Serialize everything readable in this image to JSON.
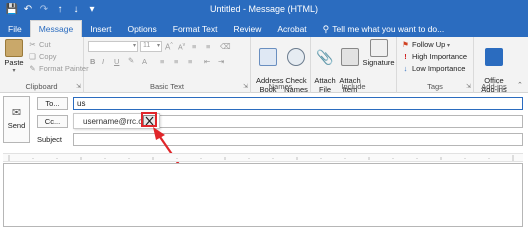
{
  "window": {
    "title": "Untitled - Message (HTML)"
  },
  "qat": {
    "icons": [
      "save-icon",
      "undo-icon",
      "redo-icon",
      "up-arrow-icon",
      "down-arrow-icon",
      "customize-icon"
    ]
  },
  "tabs": [
    {
      "label": "File",
      "active": false
    },
    {
      "label": "Message",
      "active": true
    },
    {
      "label": "Insert",
      "active": false
    },
    {
      "label": "Options",
      "active": false
    },
    {
      "label": "Format Text",
      "active": false
    },
    {
      "label": "Review",
      "active": false
    },
    {
      "label": "Acrobat",
      "active": false
    },
    {
      "label": "Tell me what you want to do...",
      "active": false
    }
  ],
  "ribbon": {
    "clipboard": {
      "label": "Clipboard",
      "paste": "Paste",
      "cut": "Cut",
      "copy": "Copy",
      "format_painter": "Format Painter"
    },
    "basic_text": {
      "label": "Basic Text",
      "font_size": "11"
    },
    "names": {
      "label": "Names",
      "address_book": "Address\nBook",
      "check_names": "Check\nNames"
    },
    "include": {
      "label": "Include",
      "attach_file": "Attach\nFile",
      "attach_item": "Attach\nItem",
      "signature": "Signature"
    },
    "tags": {
      "label": "Tags",
      "follow_up": "Follow Up",
      "high_importance": "High Importance",
      "low_importance": "Low Importance"
    },
    "addins": {
      "label": "Add-ins",
      "office_addins": "Office\nAdd-ins"
    }
  },
  "compose": {
    "send": "Send",
    "to_button": "To...",
    "to_value": "us",
    "cc_button": "Cc...",
    "cc_value": "",
    "subject_label": "Subject",
    "subject_value": ""
  },
  "autocomplete": {
    "suggestion": "username@rrc.ca"
  },
  "colors": {
    "titlebar": "#2b6cbf",
    "accent": "#2b6cbf",
    "annotation": "#e0262a"
  }
}
